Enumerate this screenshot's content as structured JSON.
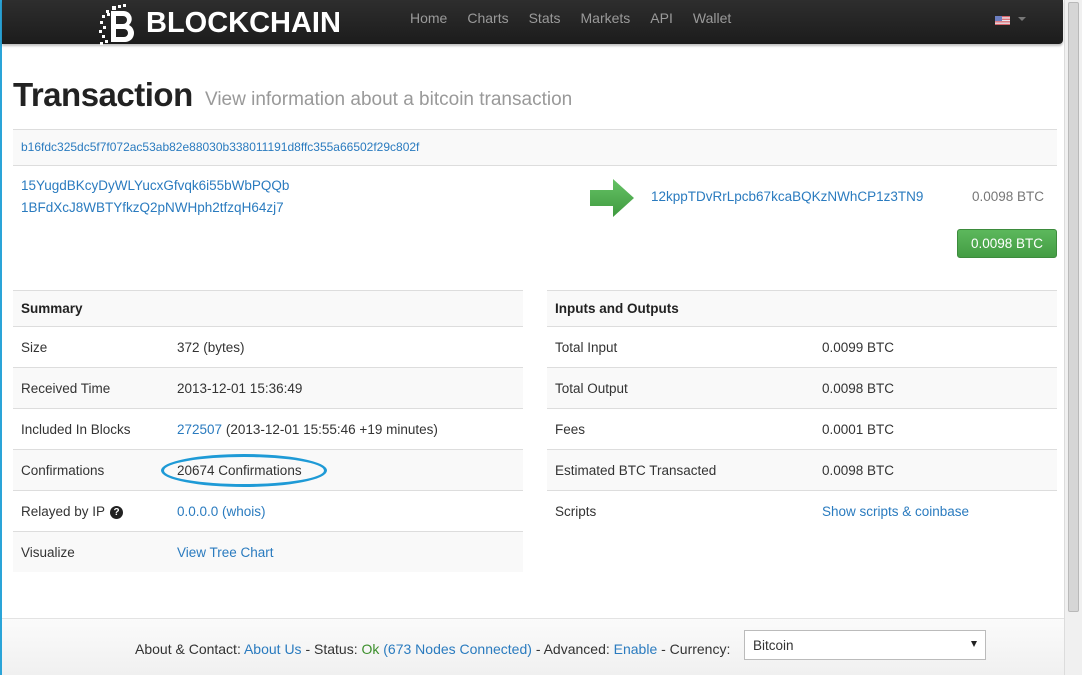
{
  "navbar": {
    "brand": "BLOCKCHAIN",
    "links": [
      "Home",
      "Charts",
      "Stats",
      "Markets",
      "API",
      "Wallet"
    ],
    "language_icon": "us-flag-icon"
  },
  "header": {
    "title": "Transaction",
    "subtitle": "View information about a bitcoin transaction"
  },
  "transaction": {
    "hash": "b16fdc325dc5f7f072ac53ab82e88030b338011191d8ffc355a66502f29c802f",
    "inputs": [
      "15YugdBKcyDyWLYucxGfvqk6i55bWbPQQb",
      "1BFdXcJ8WBTYfkzQ2pNWHph2tfzqH64zj7"
    ],
    "outputs": [
      {
        "address": "12kppTDvRrLpcb67kcaBQKzNWhCP1z3TN9",
        "amount": "0.0098 BTC"
      }
    ],
    "total_button": "0.0098 BTC"
  },
  "summary": {
    "title": "Summary",
    "rows": [
      {
        "label": "Size",
        "value": "372 (bytes)"
      },
      {
        "label": "Received Time",
        "value": "2013-12-01 15:36:49"
      },
      {
        "label": "Included In Blocks",
        "block_link": "272507",
        "value": "(2013-12-01 15:55:46 +19 minutes)"
      },
      {
        "label": "Confirmations",
        "value": "20674 Confirmations"
      },
      {
        "label": "Relayed by IP",
        "value": "0.0.0.0 (whois)"
      },
      {
        "label": "Visualize",
        "value": "View Tree Chart"
      }
    ]
  },
  "io": {
    "title": "Inputs and Outputs",
    "rows": [
      {
        "label": "Total Input",
        "value": "0.0099 BTC"
      },
      {
        "label": "Total Output",
        "value": "0.0098 BTC"
      },
      {
        "label": "Fees",
        "value": "0.0001 BTC"
      },
      {
        "label": "Estimated BTC Transacted",
        "value": "0.0098 BTC"
      },
      {
        "label": "Scripts",
        "value": "Show scripts & coinbase"
      }
    ]
  },
  "footer": {
    "about_label": "About & Contact:",
    "about_link": "About Us",
    "status_label": "- Status:",
    "status_ok": "Ok",
    "nodes_link": "(673 Nodes Connected)",
    "advanced_label": "- Advanced:",
    "advanced_link": "Enable",
    "currency_label": "- Currency:",
    "currency_value": "Bitcoin"
  },
  "colors": {
    "link": "#2a7bbf",
    "success": "#5cb85c",
    "highlight": "#1e9ad6",
    "status_ok": "#3c8f2c"
  }
}
